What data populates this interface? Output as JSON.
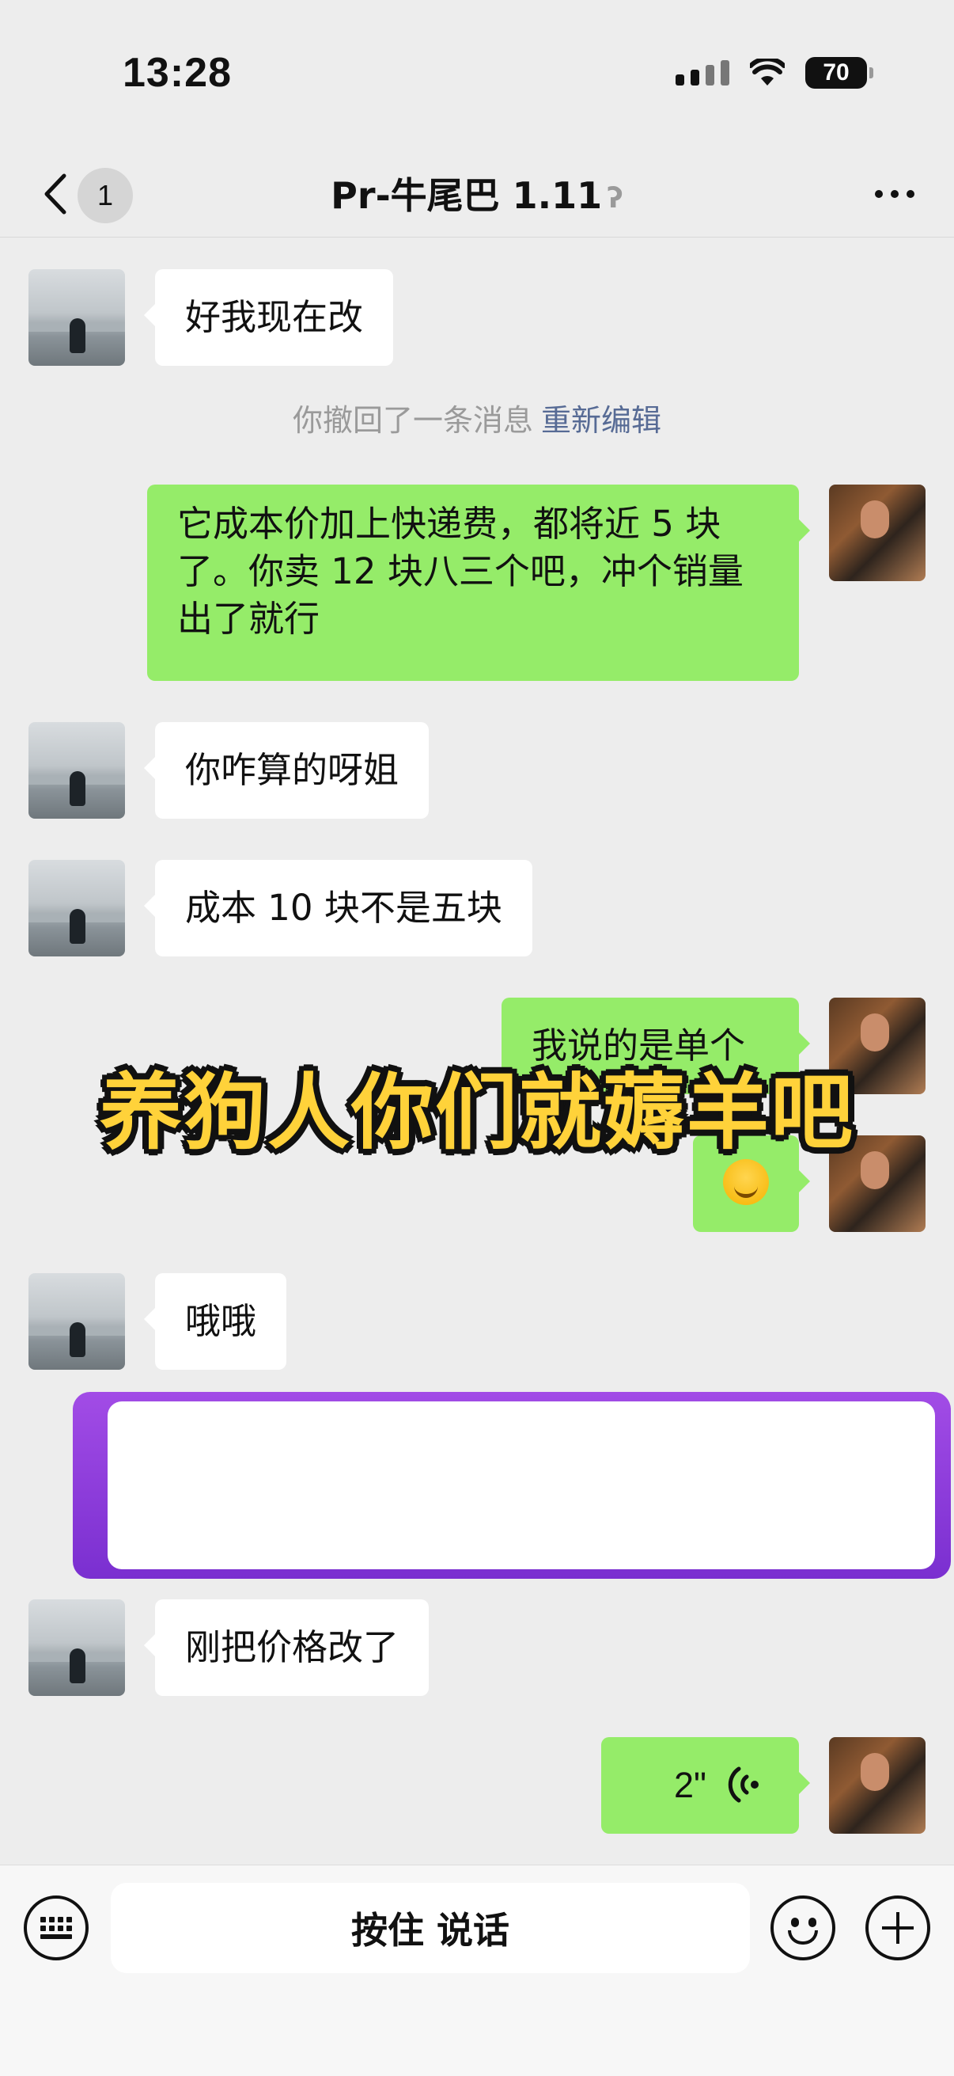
{
  "status_bar": {
    "time": "13:28",
    "battery": "70"
  },
  "nav": {
    "unread_count": "1",
    "title": "Pr-牛尾巴 1.11"
  },
  "messages": [
    {
      "side": "left",
      "text": "好我现在改"
    },
    {
      "side": "right",
      "text": "它成本价加上快递费，都将近 5 块了。你卖 12 块八三个吧，冲个销量出了就行"
    },
    {
      "side": "left",
      "text": "你咋算的呀姐"
    },
    {
      "side": "left",
      "text": "成本 10 块不是五块"
    },
    {
      "side": "right",
      "text": "我说的是单个"
    },
    {
      "side": "right",
      "emoji": "laughing-crying-emoji"
    },
    {
      "side": "left",
      "text": "哦哦"
    },
    {
      "side": "left",
      "text": "刚把价格改了"
    },
    {
      "side": "right",
      "voice_duration": "2\""
    }
  ],
  "recall_notice": {
    "text": "你撤回了一条消息",
    "edit_label": "重新编辑"
  },
  "overlay_caption": "养狗人你们就薅羊吧",
  "bottom_bar": {
    "hold_to_talk_label": "按住 说话"
  },
  "colors": {
    "outgoing_bubble": "#95ec69",
    "incoming_bubble": "#ffffff",
    "link": "#576b95",
    "caption": "#ffd23a",
    "frame": "#8a3bd9"
  }
}
